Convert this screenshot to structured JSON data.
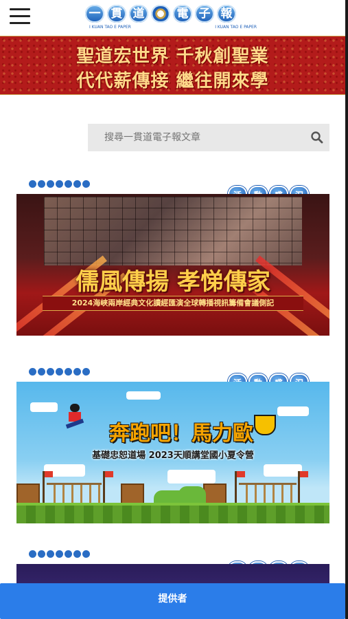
{
  "header": {
    "menu_icon": "hamburger-menu-icon",
    "logo_chars": [
      "一",
      "貫",
      "道",
      "",
      "電",
      "子",
      "報"
    ],
    "logo_sub_left": "I KUAN TAO E PAPER",
    "logo_sub_right": "I KUAN TAO E PAPER"
  },
  "banner": {
    "line1": "聖道宏世界 千秋創聖業",
    "line2": "代代薪傳接 繼往開來學"
  },
  "search": {
    "placeholder": "搜尋一貫道電子報文章",
    "icon": "search-icon"
  },
  "articles": [
    {
      "tag": [
        "活",
        "動",
        "盛",
        "況"
      ],
      "headline": "儒風傳揚 孝悌傳家",
      "subline": "2024海峽兩岸經典文化讀經匯演全球轉播視訊籌備會議側記"
    },
    {
      "tag": [
        "活",
        "動",
        "盛",
        "況"
      ],
      "headline": "奔跑吧！馬力歐",
      "subline": "基礎忠恕道場 2023天順講堂國小夏令營"
    },
    {
      "tag": [
        "活",
        "動",
        "盛",
        "況"
      ]
    }
  ],
  "footer": {
    "label": "提供者"
  },
  "colors": {
    "banner_red": "#b31b1b",
    "footer_blue": "#2b7de9",
    "tag_blue": "#1c5cb5"
  }
}
